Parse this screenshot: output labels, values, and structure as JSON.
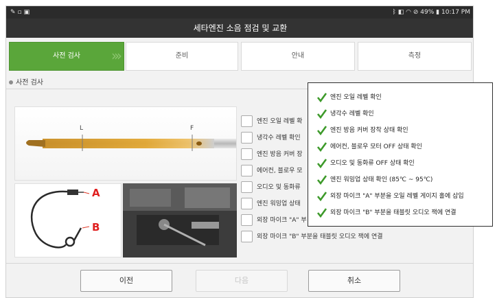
{
  "status_bar": {
    "left_icons": [
      "wrench-icon",
      "screenshot-icon",
      "gallery-icon"
    ],
    "right_text": "49%",
    "time": "10:17 PM",
    "right_icons": [
      "bluetooth-icon",
      "nfc-icon",
      "wifi-icon",
      "block-icon",
      "battery-icon"
    ]
  },
  "header": {
    "title": "세타엔진 소음 점검 및 교환"
  },
  "steps": [
    {
      "label": "사전 검사",
      "active": true
    },
    {
      "label": "준비",
      "active": false
    },
    {
      "label": "안내",
      "active": false
    },
    {
      "label": "측정",
      "active": false
    }
  ],
  "section": {
    "title": "사전 검사"
  },
  "dipstick": {
    "low_mark": "L",
    "full_mark": "F"
  },
  "mic_photo": {
    "label_a": "A",
    "label_b": "B"
  },
  "checklist": [
    {
      "label": "엔진 오일 레벨 확",
      "checked": false
    },
    {
      "label": "냉각수 레벨 확인",
      "checked": false
    },
    {
      "label": "엔진 방음 커버 장",
      "checked": false
    },
    {
      "label": "에어컨, 블로우 모",
      "checked": false
    },
    {
      "label": "오디오 및 동화류",
      "checked": false
    },
    {
      "label": "엔진 워밍업 상태",
      "checked": false
    },
    {
      "label": "외장 마이크 \"A\" 부",
      "checked": false
    },
    {
      "label": "외장 마이크 \"B\" 부분을 태블릿 오디오 잭에 연결",
      "checked": false
    }
  ],
  "overlay_checklist": [
    {
      "label": "엔진 오일 레벨 확인",
      "checked": true
    },
    {
      "label": "냉각수 레벨 확인",
      "checked": true
    },
    {
      "label": "엔진 방음 커버 장착 상태 확인",
      "checked": true
    },
    {
      "label": "에어컨, 블로우 모터 OFF 상태 확인",
      "checked": true
    },
    {
      "label": "오디오 및 동화류 OFF 상태 확인",
      "checked": true
    },
    {
      "label": "엔진 워밍업 상태 확인 (85℃ ~ 95℃)",
      "checked": true
    },
    {
      "label": "외장 마이크 \"A\" 부분을 오일 레벨 게이지 홀에 삽입",
      "checked": true
    },
    {
      "label": "외장 마이크 \"B\" 부분을 태블릿 오디오 잭에 연결",
      "checked": true
    }
  ],
  "buttons": {
    "prev": "이전",
    "next": "다음",
    "cancel": "취소"
  },
  "colors": {
    "accent_green": "#5aa63a",
    "check_green": "#3d9a2a",
    "header_dark": "#333333"
  }
}
